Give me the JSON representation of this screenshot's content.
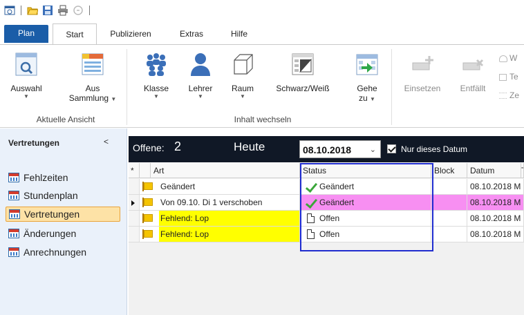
{
  "qat": {
    "icons": [
      "app-menu-icon",
      "folder-open-icon",
      "save-icon",
      "print-icon",
      "disabled-circle-icon"
    ]
  },
  "tabs": {
    "file": "Plan",
    "items": [
      "Start",
      "Publizieren",
      "Extras",
      "Hilfe"
    ]
  },
  "ribbon": {
    "auswahl": "Auswahl",
    "sammlung_1": "Aus",
    "sammlung_2": "Sammlung",
    "group_ansicht": "Aktuelle Ansicht",
    "klasse": "Klasse",
    "lehrer": "Lehrer",
    "raum": "Raum",
    "schwarz_weiss": "Schwarz/Weiß",
    "gehe_1": "Gehe",
    "gehe_2": "zu",
    "group_inhalt": "Inhalt wechseln",
    "einsetzen": "Einsetzen",
    "entfaellt": "Entfällt",
    "side_1": "W",
    "side_2": "Te",
    "side_3": "Ze"
  },
  "leftpanel": {
    "title": "Vertretungen",
    "collapse": "<",
    "items": [
      "Fehlzeiten",
      "Stundenplan",
      "Vertretungen",
      "Änderungen",
      "Anrechnungen"
    ],
    "active_index": 2
  },
  "header": {
    "offene_label": "Offene:",
    "offene_count": "2",
    "heute": "Heute",
    "date": "08.10.2018",
    "nur_datum": "Nur dieses Datum",
    "nur_datum_checked": true
  },
  "grid": {
    "columns": [
      "*",
      "Art",
      "Status",
      "Block",
      "Datum",
      "T"
    ],
    "rows": [
      {
        "art": "Geändert",
        "status": "Geändert",
        "status_icon": "check-icon",
        "datum": "08.10.2018 M",
        "highlight": "none",
        "selected": false
      },
      {
        "art": "Von 09.10. Di 1 verschoben",
        "status": "Geändert",
        "status_icon": "check-icon",
        "datum": "08.10.2018 M",
        "highlight": "pink",
        "selected": true
      },
      {
        "art": "Fehlend: Lop",
        "status": "Offen",
        "status_icon": "document-icon",
        "datum": "08.10.2018 M",
        "highlight": "yellow",
        "selected": false
      },
      {
        "art": "Fehlend: Lop",
        "status": "Offen",
        "status_icon": "document-icon",
        "datum": "08.10.2018 M",
        "highlight": "yellow",
        "selected": false
      }
    ]
  },
  "colors": {
    "file_tab": "#1a5da8",
    "darkbar": "#101826",
    "highlight_pink": "#f78ff2",
    "highlight_yellow": "#ffff00",
    "active_item": "#fde2a6",
    "focus_border": "#1f2ccf"
  }
}
